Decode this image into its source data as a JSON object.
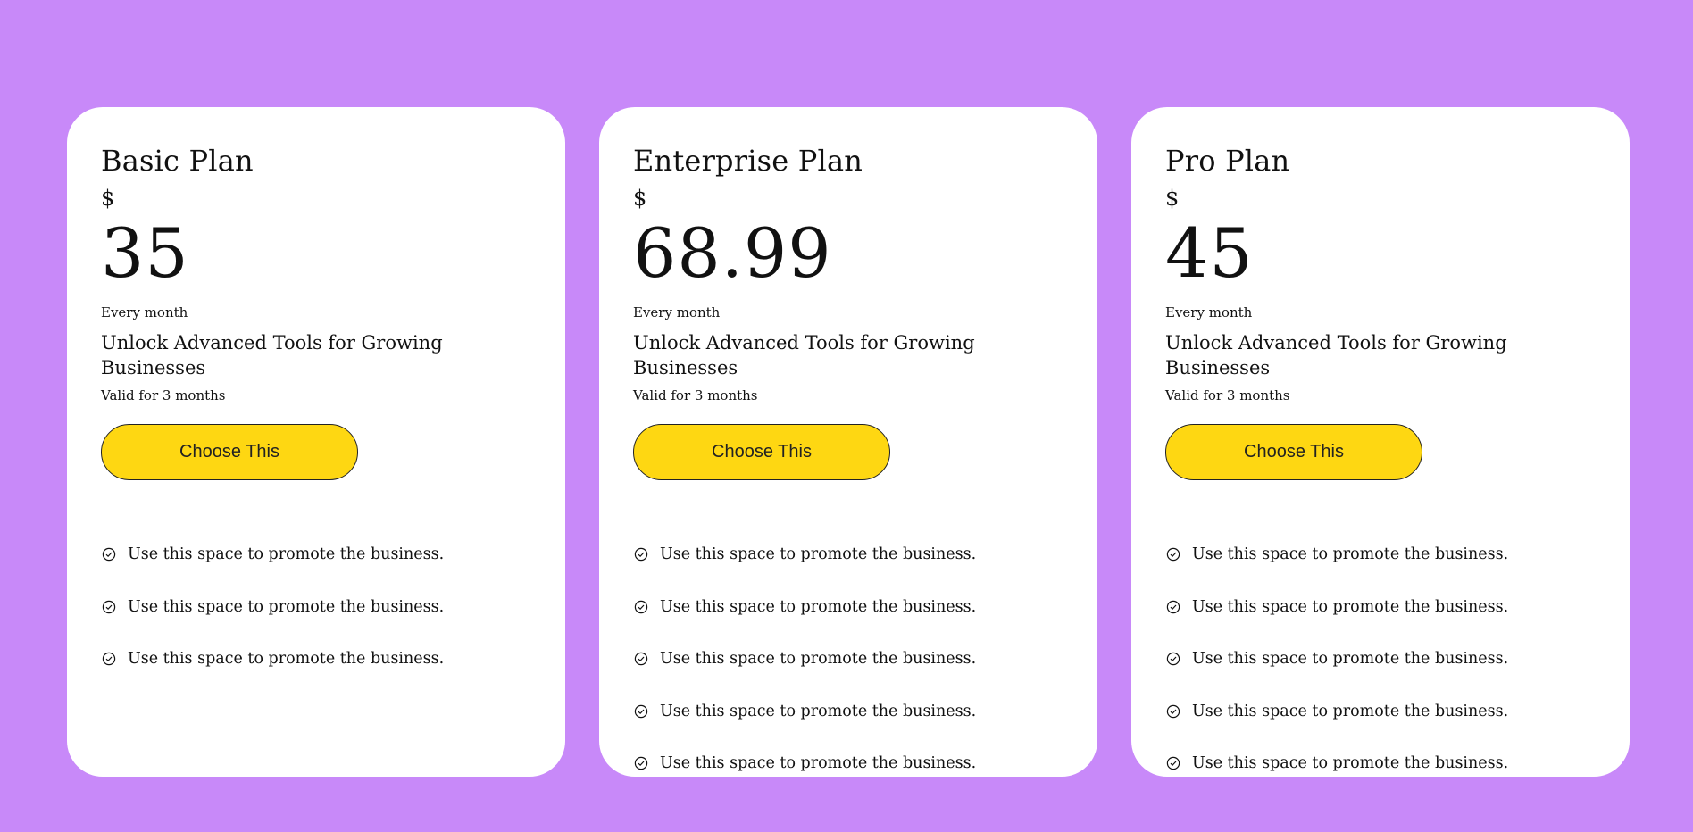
{
  "colors": {
    "background": "#c889f9",
    "card": "#ffffff",
    "button": "#fed712"
  },
  "plans": [
    {
      "name": "Basic Plan",
      "currency": "$",
      "price": "35",
      "period": "Every month",
      "tagline": "Unlock Advanced Tools for Growing Businesses",
      "validity": "Valid for 3 months",
      "button_label": "Choose This",
      "features": [
        "Use this space to promote the business.",
        "Use this space to promote the business.",
        "Use this space to promote the business."
      ]
    },
    {
      "name": "Enterprise Plan",
      "currency": "$",
      "price": "68.99",
      "period": "Every month",
      "tagline": "Unlock Advanced Tools for Growing Businesses",
      "validity": "Valid for 3 months",
      "button_label": "Choose This",
      "features": [
        "Use this space to promote the business.",
        "Use this space to promote the business.",
        "Use this space to promote the business.",
        "Use this space to promote the business.",
        "Use this space to promote the business."
      ]
    },
    {
      "name": "Pro Plan",
      "currency": "$",
      "price": "45",
      "period": "Every month",
      "tagline": "Unlock Advanced Tools for Growing Businesses",
      "validity": "Valid for 3 months",
      "button_label": "Choose This",
      "features": [
        "Use this space to promote the business.",
        "Use this space to promote the business.",
        "Use this space to promote the business.",
        "Use this space to promote the business.",
        "Use this space to promote the business."
      ]
    }
  ],
  "feature_icon": "check-circle-icon"
}
